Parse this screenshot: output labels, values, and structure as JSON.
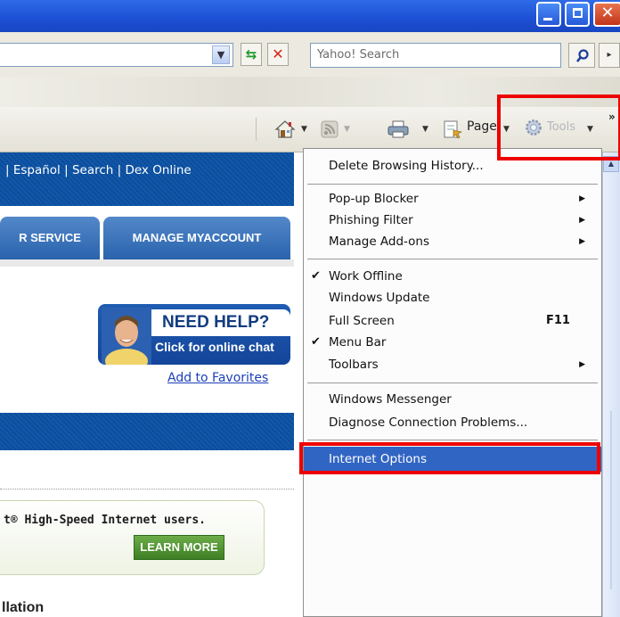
{
  "address_bar": {
    "search_placeholder": "Yahoo! Search"
  },
  "command_bar": {
    "page_label": "Page",
    "tools_label": "Tools",
    "more_label": "»"
  },
  "webpage": {
    "top_nav": "| Español | Search | Dex Online",
    "tabs": [
      "R SERVICE",
      "MANAGE MYACCOUNT"
    ],
    "help_title": "NEED HELP?",
    "help_subtitle": "Click for online chat",
    "add_favorites": "Add to Favorites",
    "promo_text": "t® High-Speed Internet users.",
    "learn_more": "LEARN MORE",
    "install_heading": "llation"
  },
  "tools_menu": {
    "items": [
      {
        "label": "Delete Browsing History..."
      },
      {
        "label": "Pop-up Blocker"
      },
      {
        "label": "Phishing Filter"
      },
      {
        "label": "Manage Add-ons"
      },
      {
        "label": "Work Offline"
      },
      {
        "label": "Windows Update"
      },
      {
        "label": "Full Screen",
        "shortcut": "F11"
      },
      {
        "label": "Menu Bar"
      },
      {
        "label": "Toolbars"
      },
      {
        "label": "Windows Messenger"
      },
      {
        "label": "Diagnose Connection Problems..."
      },
      {
        "label": "Internet Options"
      }
    ]
  },
  "icons": {
    "title_min": "minimize-icon",
    "title_max": "maximize-icon",
    "title_close": "close-icon",
    "refresh": "refresh-icon",
    "stop": "stop-icon",
    "search": "search-icon",
    "home": "home-icon",
    "feeds": "rss-feed-icon",
    "print": "printer-icon",
    "page": "page-icon",
    "tools": "gear-icon"
  },
  "colors": {
    "titlebar": "#1c4fd4",
    "highlight_box": "#ee0000",
    "menu_selection": "#3165c4",
    "site_blue": "#0c4d9c"
  }
}
